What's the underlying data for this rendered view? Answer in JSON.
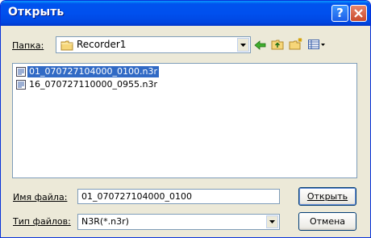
{
  "window": {
    "title": "Открыть"
  },
  "lookin": {
    "label": "Папка:",
    "value": "Recorder1"
  },
  "files": [
    {
      "name": "01_070727104000_0100.n3r",
      "selected": true
    },
    {
      "name": "16_070727110000_0955.n3r",
      "selected": false
    }
  ],
  "filename": {
    "label": "Имя файла:",
    "value": "01_070727104000_0100"
  },
  "filetype": {
    "label": "Тип файлов:",
    "value": "N3R(*.n3r)"
  },
  "buttons": {
    "open": "Открыть",
    "cancel": "Отмена"
  },
  "icons": {
    "help": "help-icon",
    "close": "close-icon",
    "folder": "folder-icon",
    "back": "back-arrow-icon",
    "up": "up-folder-icon",
    "new_folder": "new-folder-icon",
    "view_menu": "view-menu-icon",
    "file": "file-icon"
  },
  "colors": {
    "title_bar": "#0054e3",
    "selection": "#316ac5",
    "dialog_bg": "#ece9d8"
  }
}
